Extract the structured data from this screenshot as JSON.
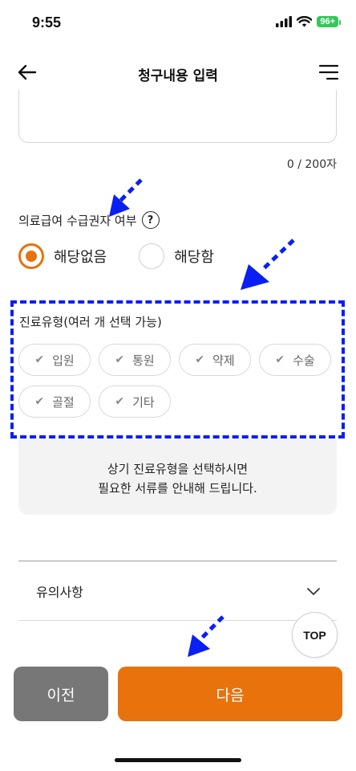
{
  "status_bar": {
    "time": "9:55",
    "battery": "96+"
  },
  "header": {
    "title": "청구내용 입력"
  },
  "memo": {
    "counter": "0 / 200자"
  },
  "medical_aid": {
    "question": "의료급여 수급권자 여부",
    "help_symbol": "?",
    "options": [
      {
        "label": "해당없음",
        "selected": true
      },
      {
        "label": "해당함",
        "selected": false
      }
    ]
  },
  "care_type": {
    "title": "진료유형(여러 개 선택 가능)",
    "chips": [
      "입원",
      "통원",
      "약제",
      "수술",
      "골절",
      "기타"
    ]
  },
  "info": {
    "line1": "상기 진료유형을 선택하시면",
    "line2": "필요한 서류를 안내해 드립니다."
  },
  "notice": {
    "label": "유의사항"
  },
  "top_button": {
    "label": "TOP"
  },
  "footer": {
    "prev_label": "이전",
    "next_label": "다음"
  },
  "colors": {
    "accent": "#e8720c",
    "annotation": "#0a1ff5",
    "secondary_button": "#777777"
  }
}
